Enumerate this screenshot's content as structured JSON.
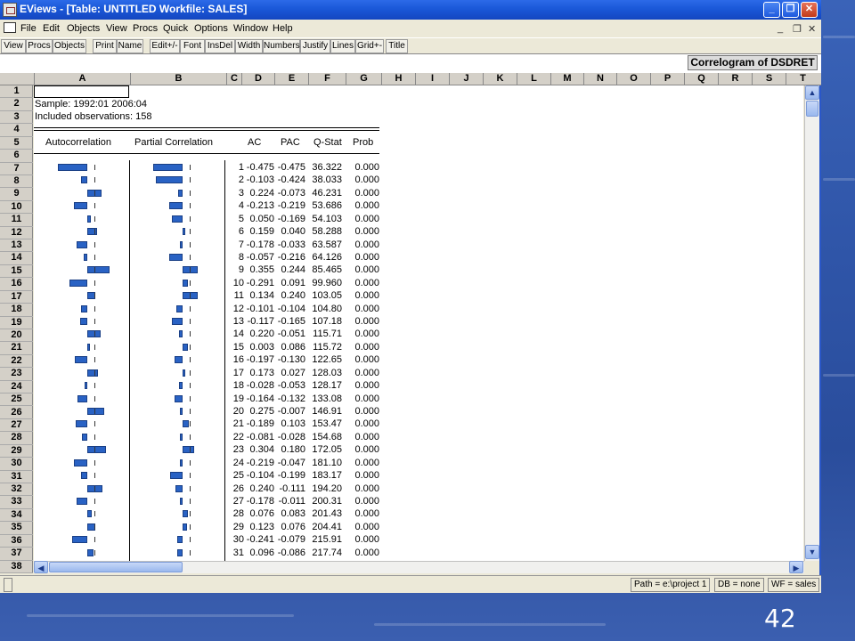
{
  "window": {
    "title": "EViews - [Table: UNTITLED    Workfile: SALES]"
  },
  "menu": [
    "File",
    "Edit",
    "Objects",
    "View",
    "Procs",
    "Quick",
    "Options",
    "Window",
    "Help"
  ],
  "toolbar": [
    "View",
    "Procs",
    "Objects",
    "Print",
    "Name",
    "Edit+/-",
    "Font",
    "InsDel",
    "Width",
    "Numbers",
    "Justify",
    "Lines",
    "Grid+-",
    "Title"
  ],
  "table_title": "Correlogram of DSDRET",
  "columns": [
    "A",
    "B",
    "C",
    "D",
    "E",
    "F",
    "G",
    "H",
    "I",
    "J",
    "K",
    "L",
    "M",
    "N",
    "O",
    "P",
    "Q",
    "R",
    "S",
    "T"
  ],
  "rows": [
    "1",
    "2",
    "3",
    "4",
    "5",
    "6",
    "7",
    "8",
    "9",
    "10",
    "11",
    "12",
    "13",
    "14",
    "15",
    "16",
    "17",
    "18",
    "19",
    "20",
    "21",
    "22",
    "23",
    "24",
    "25",
    "26",
    "27",
    "28",
    "29",
    "30",
    "31",
    "32",
    "33",
    "34",
    "35",
    "36",
    "37",
    "38"
  ],
  "info": {
    "sample": "Sample: 1992:01 2006:04",
    "obs": "Included observations: 158"
  },
  "headers": {
    "ac_graph": "Autocorrelation",
    "pac_graph": "Partial Correlation",
    "ac": "AC",
    "pac": "PAC",
    "q": "Q-Stat",
    "prob": "Prob"
  },
  "correlogram": [
    {
      "lag": "1",
      "ac": "-0.475",
      "pac": "-0.475",
      "q": "36.322",
      "prob": "0.000"
    },
    {
      "lag": "2",
      "ac": "-0.103",
      "pac": "-0.424",
      "q": "38.033",
      "prob": "0.000"
    },
    {
      "lag": "3",
      "ac": "0.224",
      "pac": "-0.073",
      "q": "46.231",
      "prob": "0.000"
    },
    {
      "lag": "4",
      "ac": "-0.213",
      "pac": "-0.219",
      "q": "53.686",
      "prob": "0.000"
    },
    {
      "lag": "5",
      "ac": "0.050",
      "pac": "-0.169",
      "q": "54.103",
      "prob": "0.000"
    },
    {
      "lag": "6",
      "ac": "0.159",
      "pac": "0.040",
      "q": "58.288",
      "prob": "0.000"
    },
    {
      "lag": "7",
      "ac": "-0.178",
      "pac": "-0.033",
      "q": "63.587",
      "prob": "0.000"
    },
    {
      "lag": "8",
      "ac": "-0.057",
      "pac": "-0.216",
      "q": "64.126",
      "prob": "0.000"
    },
    {
      "lag": "9",
      "ac": "0.355",
      "pac": "0.244",
      "q": "85.465",
      "prob": "0.000"
    },
    {
      "lag": "10",
      "ac": "-0.291",
      "pac": "0.091",
      "q": "99.960",
      "prob": "0.000"
    },
    {
      "lag": "11",
      "ac": "0.134",
      "pac": "0.240",
      "q": "103.05",
      "prob": "0.000"
    },
    {
      "lag": "12",
      "ac": "-0.101",
      "pac": "-0.104",
      "q": "104.80",
      "prob": "0.000"
    },
    {
      "lag": "13",
      "ac": "-0.117",
      "pac": "-0.165",
      "q": "107.18",
      "prob": "0.000"
    },
    {
      "lag": "14",
      "ac": "0.220",
      "pac": "-0.051",
      "q": "115.71",
      "prob": "0.000"
    },
    {
      "lag": "15",
      "ac": "0.003",
      "pac": "0.086",
      "q": "115.72",
      "prob": "0.000"
    },
    {
      "lag": "16",
      "ac": "-0.197",
      "pac": "-0.130",
      "q": "122.65",
      "prob": "0.000"
    },
    {
      "lag": "17",
      "ac": "0.173",
      "pac": "0.027",
      "q": "128.03",
      "prob": "0.000"
    },
    {
      "lag": "18",
      "ac": "-0.028",
      "pac": "-0.053",
      "q": "128.17",
      "prob": "0.000"
    },
    {
      "lag": "19",
      "ac": "-0.164",
      "pac": "-0.132",
      "q": "133.08",
      "prob": "0.000"
    },
    {
      "lag": "20",
      "ac": "0.275",
      "pac": "-0.007",
      "q": "146.91",
      "prob": "0.000"
    },
    {
      "lag": "21",
      "ac": "-0.189",
      "pac": "0.103",
      "q": "153.47",
      "prob": "0.000"
    },
    {
      "lag": "22",
      "ac": "-0.081",
      "pac": "-0.028",
      "q": "154.68",
      "prob": "0.000"
    },
    {
      "lag": "23",
      "ac": "0.304",
      "pac": "0.180",
      "q": "172.05",
      "prob": "0.000"
    },
    {
      "lag": "24",
      "ac": "-0.219",
      "pac": "-0.047",
      "q": "181.10",
      "prob": "0.000"
    },
    {
      "lag": "25",
      "ac": "-0.104",
      "pac": "-0.199",
      "q": "183.17",
      "prob": "0.000"
    },
    {
      "lag": "26",
      "ac": "0.240",
      "pac": "-0.111",
      "q": "194.20",
      "prob": "0.000"
    },
    {
      "lag": "27",
      "ac": "-0.178",
      "pac": "-0.011",
      "q": "200.31",
      "prob": "0.000"
    },
    {
      "lag": "28",
      "ac": "0.076",
      "pac": "0.083",
      "q": "201.43",
      "prob": "0.000"
    },
    {
      "lag": "29",
      "ac": "0.123",
      "pac": "0.076",
      "q": "204.41",
      "prob": "0.000"
    },
    {
      "lag": "30",
      "ac": "-0.241",
      "pac": "-0.079",
      "q": "215.91",
      "prob": "0.000"
    },
    {
      "lag": "31",
      "ac": "0.096",
      "pac": "-0.086",
      "q": "217.74",
      "prob": "0.000"
    }
  ],
  "status": {
    "path": "Path = e:\\project 1",
    "db": "DB = none",
    "wf": "WF = sales"
  },
  "slide_number": "42",
  "icons": {
    "app": "app-icon",
    "min": "minimize-icon",
    "restore": "restore-icon",
    "close": "close-icon",
    "doc": "doc-icon"
  },
  "colors": {
    "titlebar": "#1a58d8",
    "bar": "#2962c4",
    "close": "#c23a1a"
  }
}
